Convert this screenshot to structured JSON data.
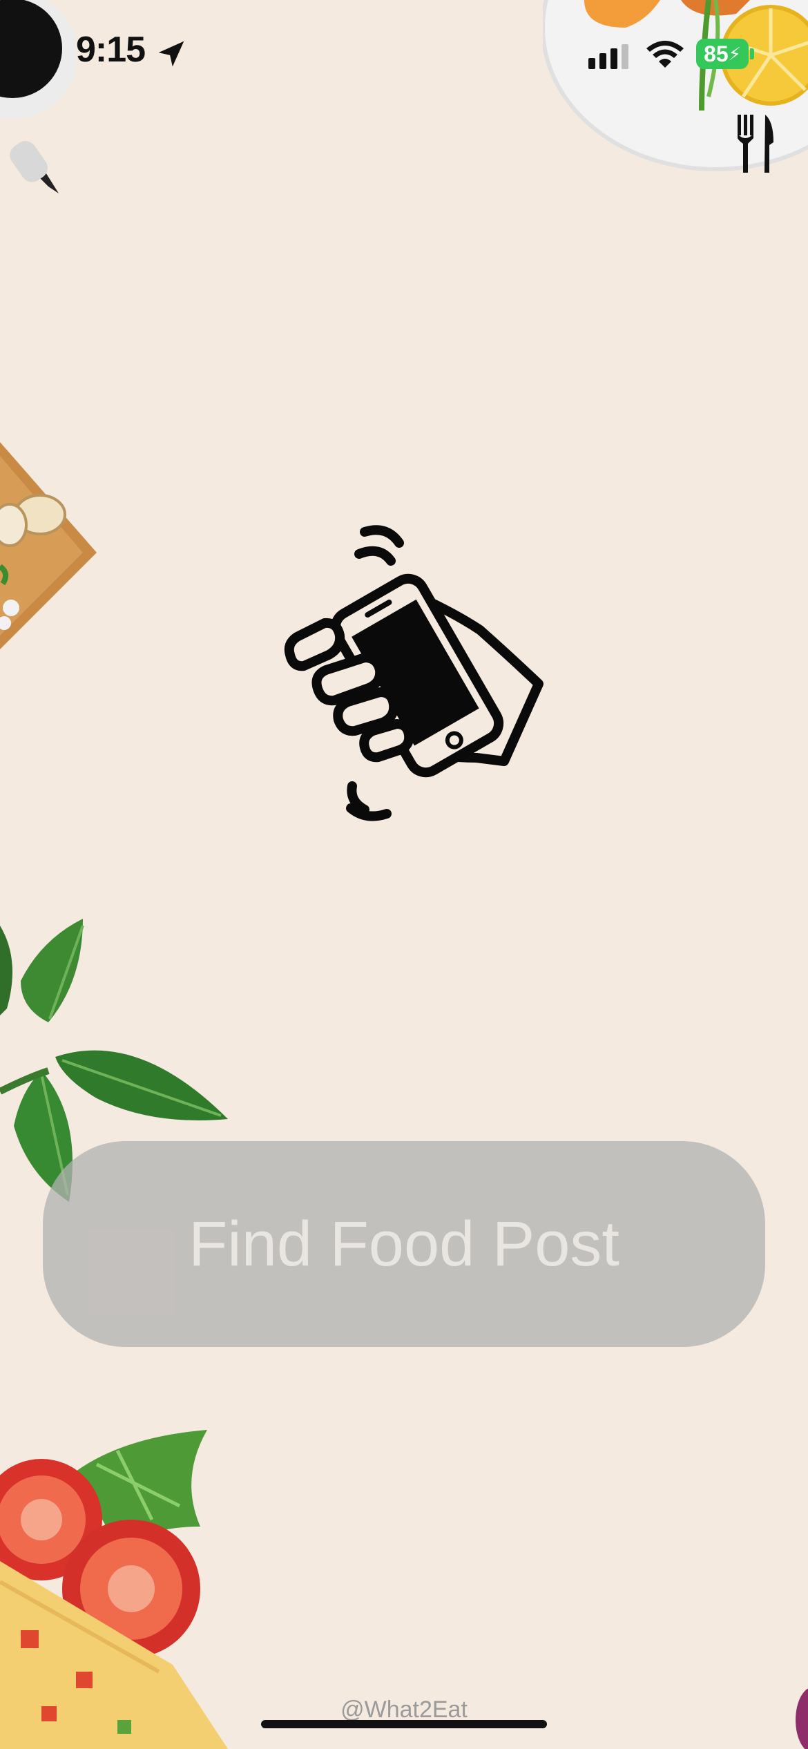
{
  "status_bar": {
    "time": "9:15",
    "battery": "85",
    "icons": [
      "location-arrow-icon",
      "cellular-signal-icon",
      "wifi-icon",
      "battery-charging-icon"
    ]
  },
  "header": {
    "icon": "cutlery-icon"
  },
  "main": {
    "illustration": "shake-phone-icon",
    "button_label": "Find Food Post"
  },
  "footer": {
    "credit": "@What2Eat"
  },
  "colors": {
    "background": "#f4eadf",
    "button_bg": "#bcbab7",
    "button_text": "#e9e6e2",
    "battery": "#34c759"
  }
}
